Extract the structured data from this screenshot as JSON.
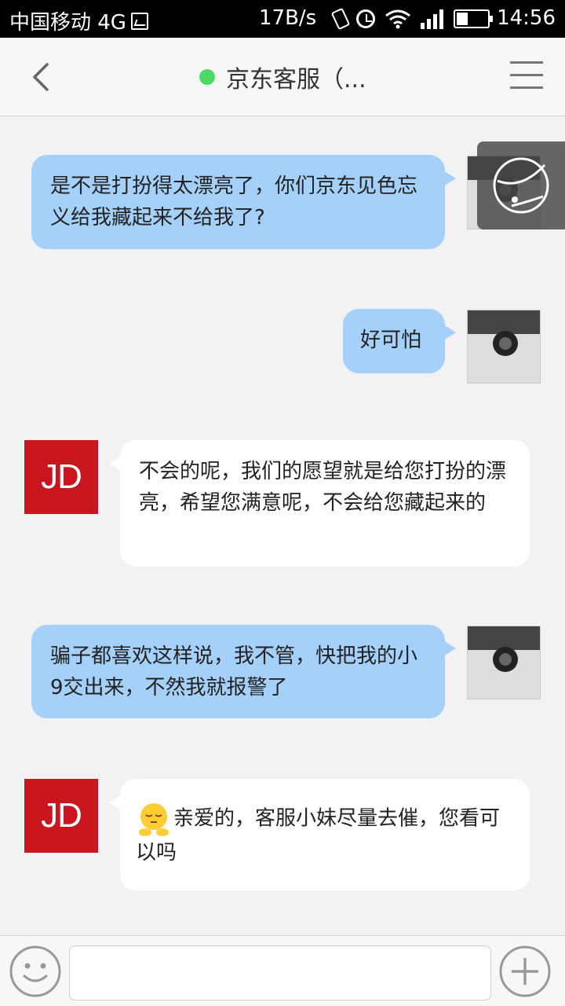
{
  "status_bar": {
    "carrier": "中国移动 4G",
    "speed": "17B/s",
    "time": "14:56"
  },
  "header": {
    "title": "京东客服（...",
    "online_color": "#4cd964"
  },
  "messages": [
    {
      "side": "out",
      "text": "是不是打扮得太漂亮了，你们京东见色忘义给我藏起来不给我了?"
    },
    {
      "side": "out",
      "text": "好可怕"
    },
    {
      "side": "in",
      "sender": "JD",
      "text": "不会的呢，我们的愿望就是给您打扮的漂亮，希望您满意呢，不会给您藏起来的"
    },
    {
      "side": "out",
      "text": "骗子都喜欢这样说，我不管，快把我的小9交出来，不然我就报警了"
    },
    {
      "side": "in",
      "sender": "JD",
      "emoji": "shy-emoji",
      "text": "亲爱的，客服小妹尽量去催，您看可以吗"
    }
  ],
  "input": {
    "value": "",
    "placeholder": ""
  },
  "colors": {
    "bubble_out": "#a5d0fa",
    "bubble_in": "#ffffff",
    "jd_red": "#c9151e",
    "background": "#f2f2f2"
  },
  "icons": {
    "back": "back-arrow-icon",
    "menu": "menu-icon",
    "emoji": "emoji-icon",
    "plus": "plus-icon",
    "float": "floating-ball-icon"
  }
}
